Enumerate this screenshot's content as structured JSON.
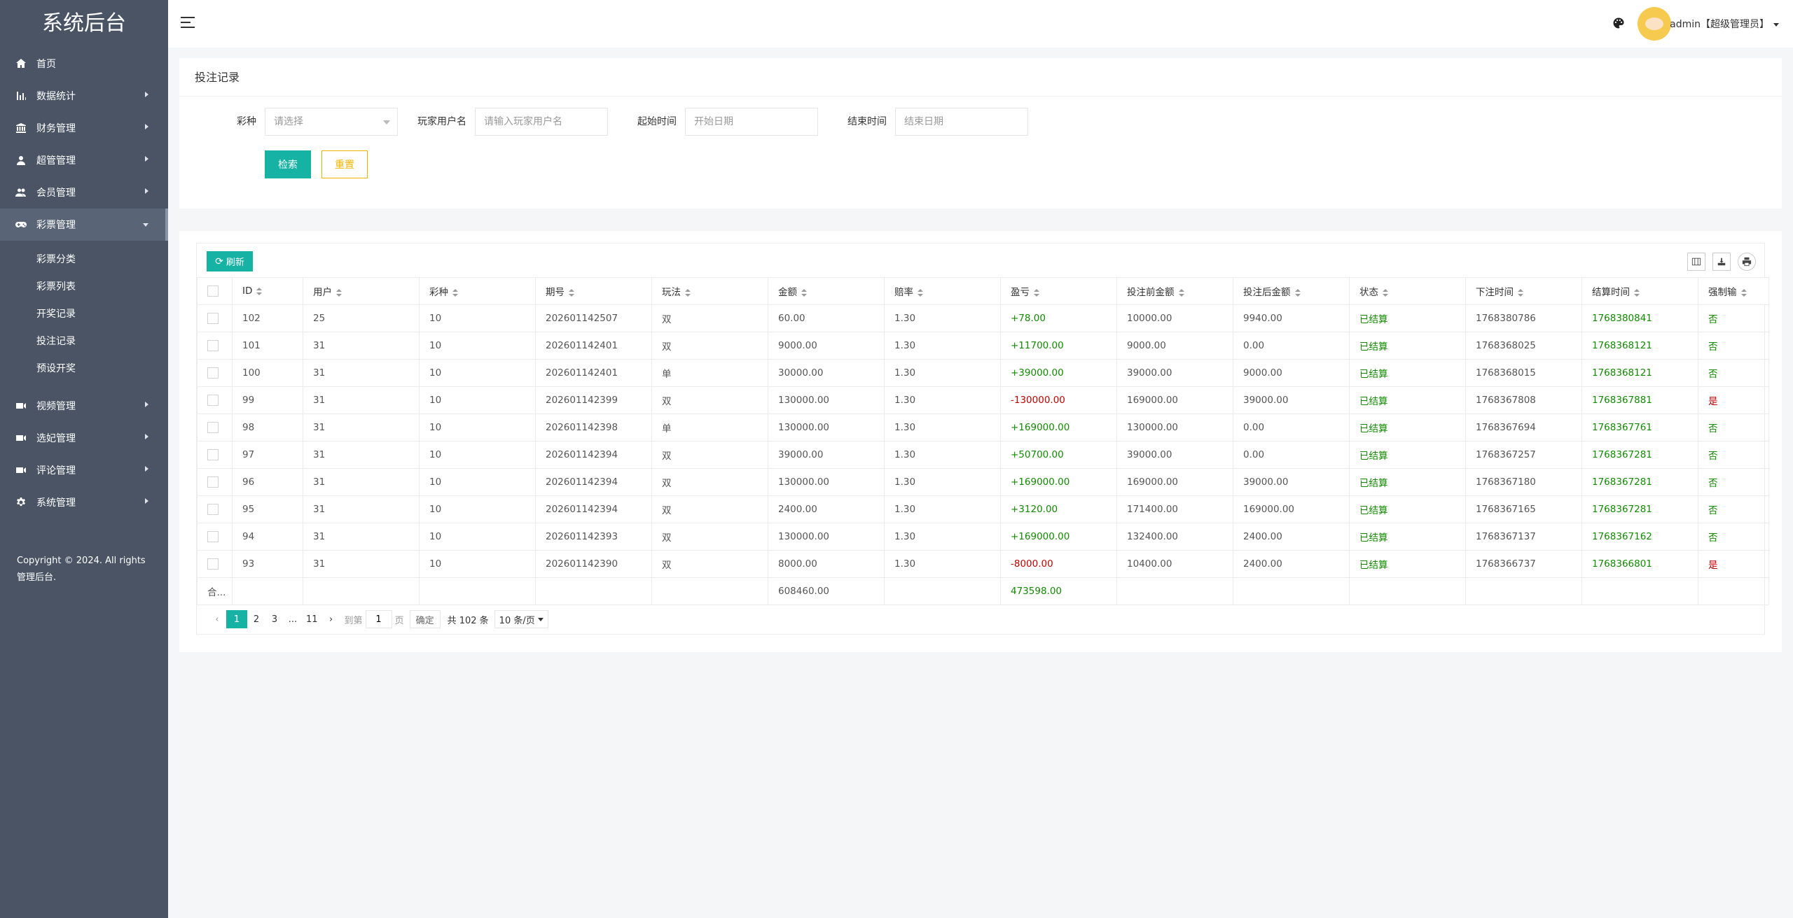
{
  "sidebar": {
    "logo": "系统后台",
    "items": [
      {
        "label": "首页",
        "icon": "home-icon",
        "arrow": false
      },
      {
        "label": "数据统计",
        "icon": "bar-chart-icon",
        "arrow": true
      },
      {
        "label": "财务管理",
        "icon": "bank-icon",
        "arrow": true
      },
      {
        "label": "超管管理",
        "icon": "user-icon",
        "arrow": true
      },
      {
        "label": "会员管理",
        "icon": "users-icon",
        "arrow": true
      },
      {
        "label": "彩票管理",
        "icon": "gamepad-icon",
        "arrow": true,
        "open": true
      }
    ],
    "subitems": [
      "彩票分类",
      "彩票列表",
      "开奖记录",
      "投注记录",
      "预设开奖"
    ],
    "items2": [
      {
        "label": "视频管理",
        "icon": "video-icon"
      },
      {
        "label": "选妃管理",
        "icon": "video-icon"
      },
      {
        "label": "评论管理",
        "icon": "video-icon"
      },
      {
        "label": "系统管理",
        "icon": "gear-icon"
      }
    ],
    "copyright": "Copyright © 2024. All rights 管理后台."
  },
  "header": {
    "user": "admin【超级管理员】"
  },
  "filter": {
    "title": "投注记录",
    "lottery_label": "彩种",
    "lottery_placeholder": "请选择",
    "player_label": "玩家用户名",
    "player_placeholder": "请输入玩家用户名",
    "start_label": "起始时间",
    "start_placeholder": "开始日期",
    "end_label": "结束时间",
    "end_placeholder": "结束日期",
    "search_label": "检索",
    "reset_label": "重置"
  },
  "toolbar": {
    "refresh_label": "刷新"
  },
  "table": {
    "columns": [
      "ID",
      "用户",
      "彩种",
      "期号",
      "玩法",
      "金额",
      "赔率",
      "盈亏",
      "投注前金额",
      "投注后金额",
      "状态",
      "下注时间",
      "结算时间",
      "强制输"
    ],
    "rows": [
      [
        "102",
        "25",
        "10",
        "202601142507",
        "双",
        "60.00",
        "1.30",
        "+78.00",
        "10000.00",
        "9940.00",
        "已结算",
        "1768380786",
        "1768380841",
        "否"
      ],
      [
        "101",
        "31",
        "10",
        "202601142401",
        "双",
        "9000.00",
        "1.30",
        "+11700.00",
        "9000.00",
        "0.00",
        "已结算",
        "1768368025",
        "1768368121",
        "否"
      ],
      [
        "100",
        "31",
        "10",
        "202601142401",
        "单",
        "30000.00",
        "1.30",
        "+39000.00",
        "39000.00",
        "9000.00",
        "已结算",
        "1768368015",
        "1768368121",
        "否"
      ],
      [
        "99",
        "31",
        "10",
        "202601142399",
        "双",
        "130000.00",
        "1.30",
        "-130000.00",
        "169000.00",
        "39000.00",
        "已结算",
        "1768367808",
        "1768367881",
        "是"
      ],
      [
        "98",
        "31",
        "10",
        "202601142398",
        "单",
        "130000.00",
        "1.30",
        "+169000.00",
        "130000.00",
        "0.00",
        "已结算",
        "1768367694",
        "1768367761",
        "否"
      ],
      [
        "97",
        "31",
        "10",
        "202601142394",
        "双",
        "39000.00",
        "1.30",
        "+50700.00",
        "39000.00",
        "0.00",
        "已结算",
        "1768367257",
        "1768367281",
        "否"
      ],
      [
        "96",
        "31",
        "10",
        "202601142394",
        "双",
        "130000.00",
        "1.30",
        "+169000.00",
        "169000.00",
        "39000.00",
        "已结算",
        "1768367180",
        "1768367281",
        "否"
      ],
      [
        "95",
        "31",
        "10",
        "202601142394",
        "双",
        "2400.00",
        "1.30",
        "+3120.00",
        "171400.00",
        "169000.00",
        "已结算",
        "1768367165",
        "1768367281",
        "否"
      ],
      [
        "94",
        "31",
        "10",
        "202601142393",
        "双",
        "130000.00",
        "1.30",
        "+169000.00",
        "132400.00",
        "2400.00",
        "已结算",
        "1768367137",
        "1768367162",
        "否"
      ],
      [
        "93",
        "31",
        "10",
        "202601142390",
        "双",
        "8000.00",
        "1.30",
        "-8000.00",
        "10400.00",
        "2400.00",
        "已结算",
        "1768366737",
        "1768366801",
        "是"
      ]
    ],
    "total_label": "合...",
    "total_amount": "608460.00",
    "total_profit": "473598.00"
  },
  "pager": {
    "pages": [
      "1",
      "2",
      "3",
      "...",
      "11"
    ],
    "goto_label": "到第",
    "goto_value": "1",
    "page_unit": "页",
    "confirm_label": "确定",
    "total_text": "共 102 条",
    "per_page": "10 条/页"
  },
  "colors": {
    "accent": "#16b3a5",
    "sidebar": "#4a5465",
    "profit_green": "#118a00",
    "loss_red": "#c10000",
    "reset_yellow": "#f0b400"
  }
}
